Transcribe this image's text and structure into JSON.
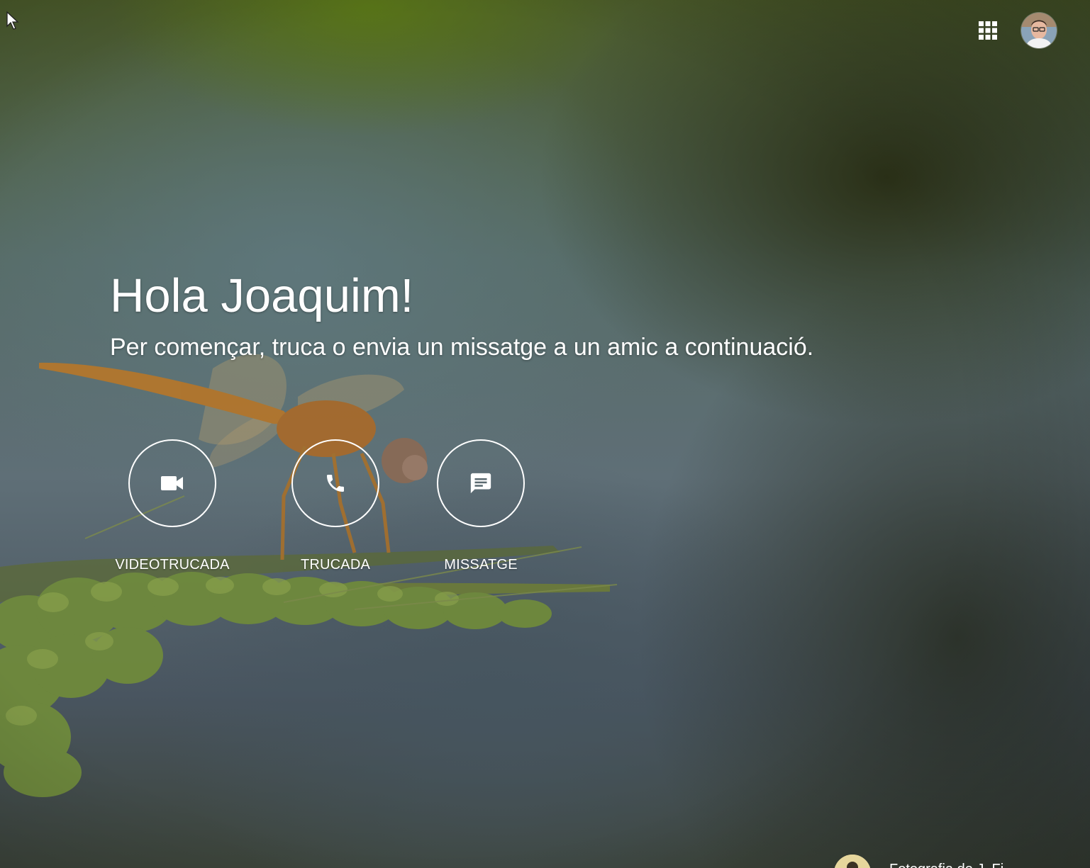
{
  "greeting": "Hola Joaquim!",
  "subtitle": "Per començar, truca o envia un missatge a un amic a continuació.",
  "actions": [
    {
      "label": "VIDEOTRUCADA",
      "icon": "video-camera-icon"
    },
    {
      "label": "TRUCADA",
      "icon": "phone-icon"
    },
    {
      "label": "MISSATGE",
      "icon": "message-icon"
    }
  ],
  "topbar": {
    "apps_icon": "apps-grid-icon",
    "avatar": "user-avatar"
  },
  "photo_credit": {
    "text": "Fotografia de J. Fi"
  },
  "colors": {
    "text": "#ffffff",
    "background_green": "#4a5a2a",
    "background_slate": "#5f6f77"
  }
}
